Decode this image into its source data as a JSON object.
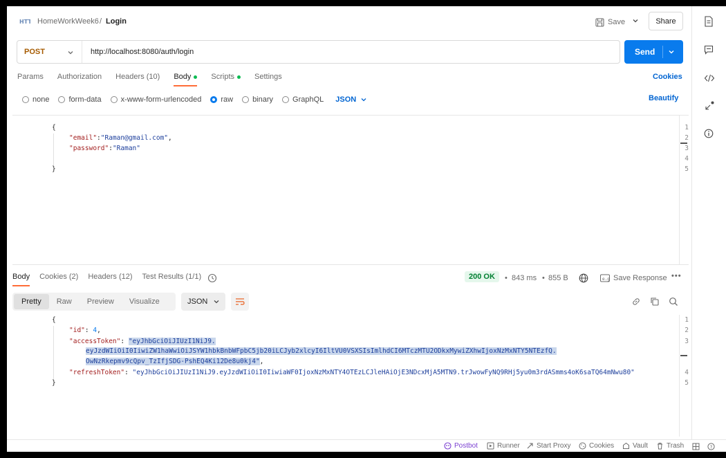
{
  "breadcrumb": {
    "workspace": "HomeWorkWeek6",
    "separator": "/",
    "page": "Login"
  },
  "header": {
    "save_label": "Save",
    "share_label": "Share"
  },
  "request": {
    "method": "POST",
    "url": "http://localhost:8080/auth/login",
    "send_label": "Send"
  },
  "request_tabs": {
    "params": "Params",
    "authorization": "Authorization",
    "headers": "Headers (10)",
    "body": "Body",
    "scripts": "Scripts",
    "settings": "Settings",
    "cookies": "Cookies"
  },
  "body_types": {
    "none": "none",
    "form_data": "form-data",
    "urlencoded": "x-www-form-urlencoded",
    "raw": "raw",
    "binary": "binary",
    "graphql": "GraphQL",
    "format": "JSON",
    "beautify": "Beautify"
  },
  "request_body": {
    "line_numbers": [
      "1",
      "2",
      "3",
      "4",
      "5"
    ],
    "open_brace": "{",
    "close_brace": "}",
    "email_key": "\"email\"",
    "email_value": "\"Raman@gmail.com\"",
    "password_key": "\"password\"",
    "password_value": "\"Raman\""
  },
  "response_tabs": {
    "body": "Body",
    "cookies": "Cookies (2)",
    "headers": "Headers (12)",
    "test_results": "Test Results (1/1)"
  },
  "response_meta": {
    "status": "200 OK",
    "time": "843 ms",
    "size": "855 B",
    "save_response": "Save Response",
    "more": "•••"
  },
  "response_view": {
    "pretty": "Pretty",
    "raw": "Raw",
    "preview": "Preview",
    "visualize": "Visualize",
    "format": "JSON"
  },
  "response_body": {
    "line_numbers": [
      "1",
      "2",
      "3",
      "",
      "",
      "4",
      "5"
    ],
    "open_brace": "{",
    "close_brace": "}",
    "id_key": "\"id\"",
    "id_value": "4",
    "access_key": "\"accessToken\"",
    "access_line1": "\"eyJhbGciOiJIUzI1NiJ9.",
    "access_line2": "eyJzdWIiOiI0IiwiZW1haWwiOiJSYW1hbkBnbWFpbC5jb20iLCJyb2xlcyI6IltVU0VSXSIsImlhdCI6MTczMTU2ODkxMywiZXhwIjoxNzMxNTY5NTEzfQ.",
    "access_line3": "OwNzRkepmv9cQpv_TzIfjSDG-PshEQ4Ki12De8u0kj4\"",
    "refresh_key": "\"refreshToken\"",
    "refresh_value": "\"eyJhbGciOiJIUzI1NiJ9.eyJzdWIiOiI0IiwiaWF0IjoxNzMxNTY4OTEzLCJleHAiOjE3NDcxMjA5MTN9.trJwowFyNQ9RHj5yu0m3rdASmms4oK6saTQ64mNwu80\""
  },
  "footer": {
    "postbot": "Postbot",
    "runner": "Runner",
    "start_proxy": "Start Proxy",
    "cookies": "Cookies",
    "vault": "Vault",
    "trash": "Trash"
  },
  "colors": {
    "accent_orange": "#ff6c37",
    "send_blue": "#097bed",
    "link_blue": "#0265d2",
    "status_green": "#007f31",
    "method_post": "#a65b00"
  }
}
